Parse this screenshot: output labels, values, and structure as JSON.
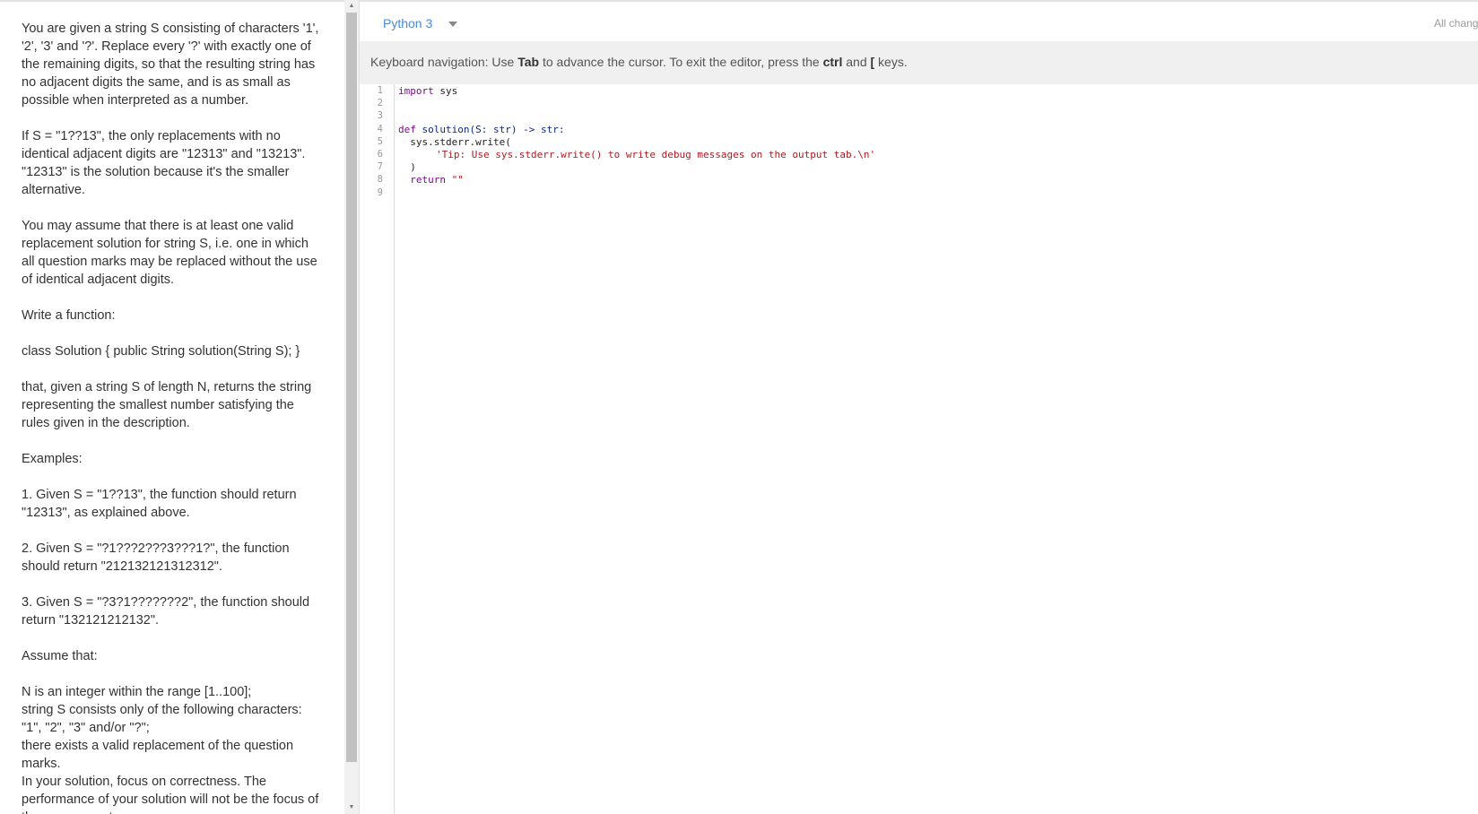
{
  "description": {
    "paragraphs": [
      "You are given a string S consisting of characters '1', '2', '3' and '?'. Replace every '?' with exactly one of the remaining digits, so that the resulting string has no adjacent digits the same, and is as small as possible when interpreted as a number.",
      "If S = \"1??13\", the only replacements with no identical adjacent digits are \"12313\" and \"13213\". \"12313\" is the solution because it's the smaller alternative.",
      "You may assume that there is at least one valid replacement solution for string S, i.e. one in which all question marks may be replaced without the use of identical adjacent digits.",
      "Write a function:",
      "class Solution { public String solution(String S); }",
      "that, given a string S of length N, returns the string representing the smallest number satisfying the rules given in the description.",
      "Examples:",
      "1. Given S = \"1??13\", the function should return \"12313\", as explained above.",
      "2. Given S = \"?1???2???3???1?\", the function should return \"212132121312312\".",
      "3. Given S = \"?3?1???????2\", the function should return \"132121212132\".",
      "Assume that:"
    ],
    "assumptions": [
      "N is an integer within the range [1..100];",
      "string S consists only of the following characters: \"1\", \"2\", \"3\" and/or \"?\";",
      "there exists a valid replacement of the question marks."
    ],
    "closing": "In your solution, focus on correctness. The performance of your solution will not be the focus of the assessment."
  },
  "toolbar": {
    "language": "Python 3",
    "all_changes": "All changes saved"
  },
  "keyboard_nav": {
    "prefix": "Keyboard navigation: Use ",
    "key_tab": "Tab",
    "middle": " to advance the cursor. To exit the editor, press the ",
    "key_ctrl": "ctrl",
    "and": " and ",
    "key_bracket": "[",
    "suffix": " keys."
  },
  "editor": {
    "line_numbers": [
      "1",
      "2",
      "3",
      "4",
      "5",
      "6",
      "7",
      "8",
      "9"
    ],
    "code": {
      "l1_kw": "import",
      "l1_rest": " sys",
      "l4_kw": "def",
      "l4_fn": " solution",
      "l4_rest": "(S: str) -> str:",
      "l5": "  sys.stderr.write(",
      "l6_str": "'Tip: Use sys.stderr.write() to write debug messages on the output tab.\\n'",
      "l7": "  )",
      "l8_kw": "  return",
      "l8_str": " \"\""
    }
  }
}
